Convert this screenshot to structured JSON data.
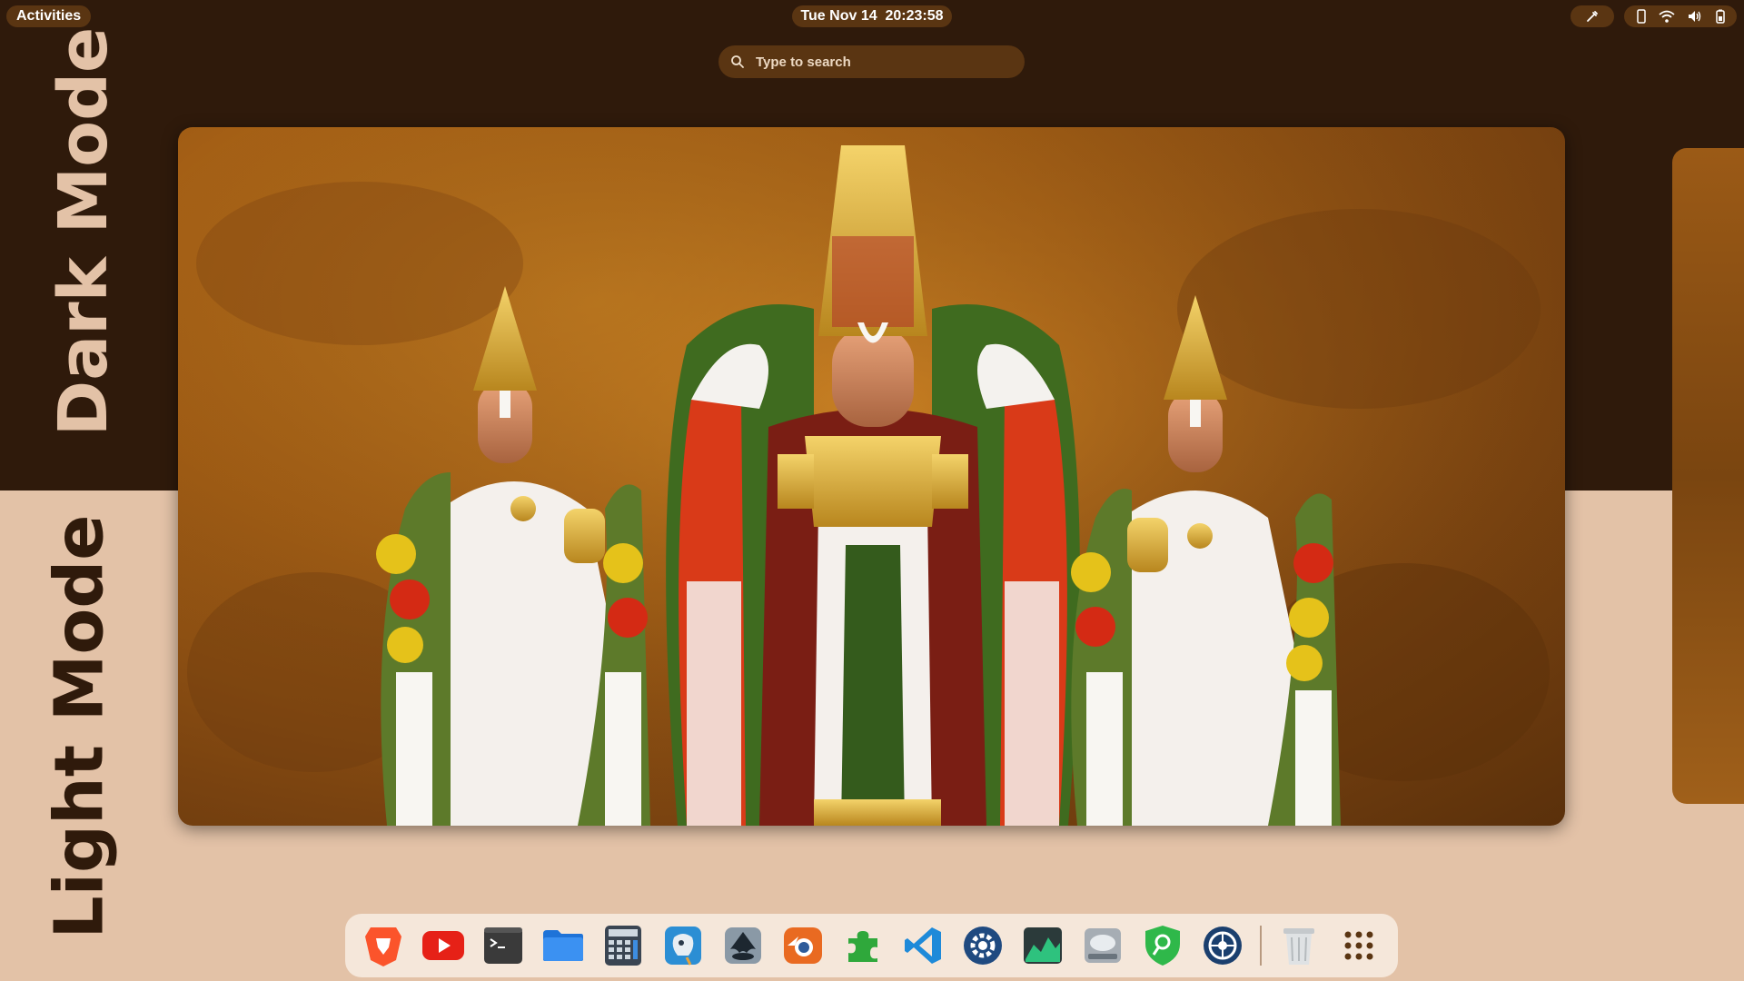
{
  "topbar": {
    "activities_label": "Activities",
    "clock": "Tue Nov 14  20:23:58"
  },
  "search": {
    "placeholder": "Type to search"
  },
  "labels": {
    "dark_mode": "Dark Mode",
    "light_mode": "Light Mode"
  },
  "colors": {
    "dark_bg": "#2f1a0b",
    "light_bg": "#e3c2a7",
    "pill_bg": "#5a3512",
    "dock_bg": "#f5e7da"
  },
  "dock": {
    "apps": [
      {
        "name": "brave-browser-icon"
      },
      {
        "name": "youtube-icon"
      },
      {
        "name": "terminal-icon"
      },
      {
        "name": "files-icon"
      },
      {
        "name": "calculator-icon"
      },
      {
        "name": "gimp-icon"
      },
      {
        "name": "inkscape-icon"
      },
      {
        "name": "blender-icon"
      },
      {
        "name": "extensions-icon"
      },
      {
        "name": "vscode-icon"
      },
      {
        "name": "settings-icon"
      },
      {
        "name": "system-monitor-icon"
      },
      {
        "name": "disk-usage-icon"
      },
      {
        "name": "security-shield-icon"
      },
      {
        "name": "preferences-icon"
      }
    ],
    "trash": {
      "name": "trash-icon"
    },
    "app_grid": {
      "name": "app-grid-icon"
    }
  }
}
